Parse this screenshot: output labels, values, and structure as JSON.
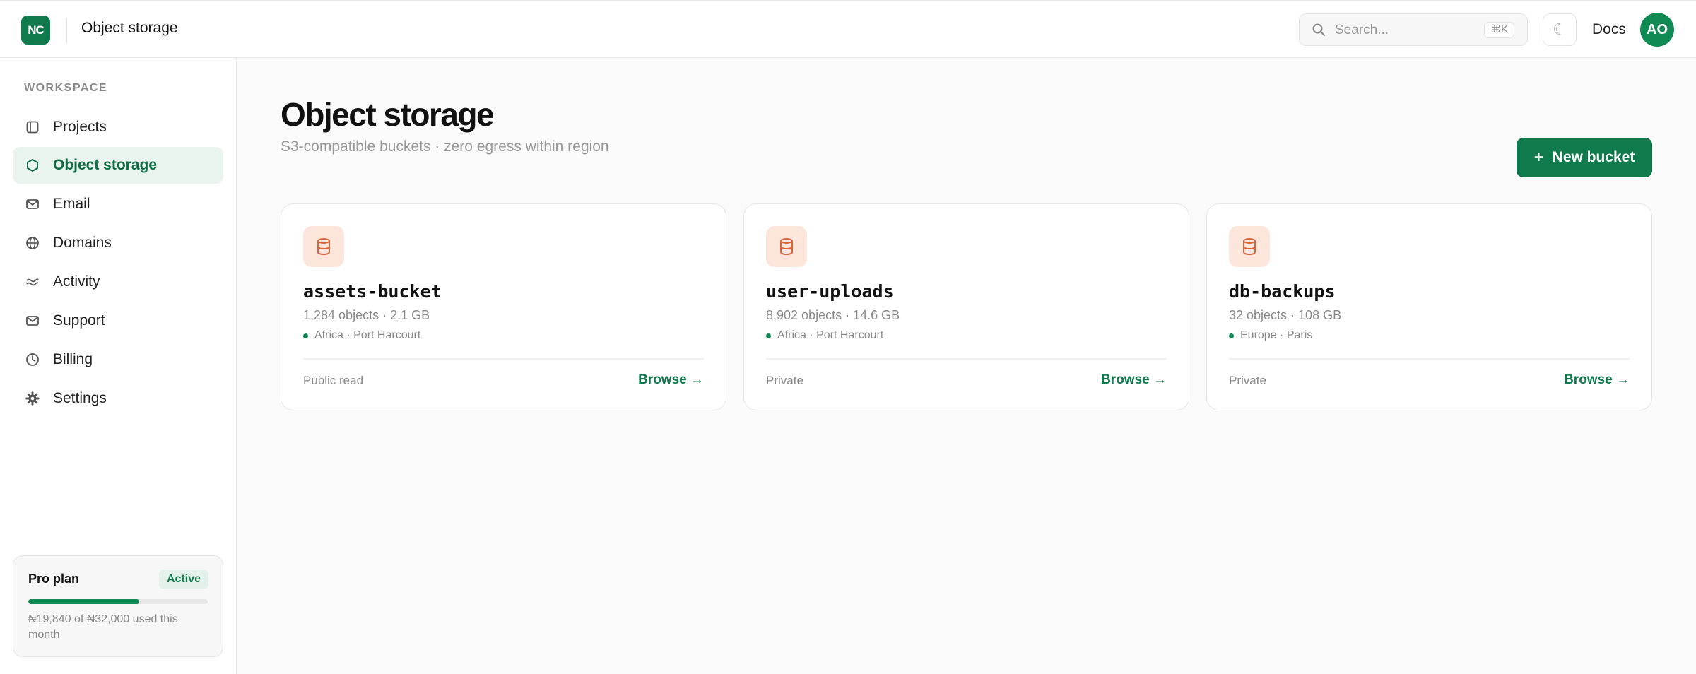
{
  "topbar": {
    "logo_text": "NC",
    "title": "Object storage",
    "search_placeholder": "Search...",
    "search_shortcut": "⌘K",
    "theme_icon": "moon-icon",
    "docs_label": "Docs",
    "avatar_initials": "AO"
  },
  "sidebar": {
    "section_label": "WORKSPACE",
    "items": [
      {
        "label": "Projects",
        "icon": "folder-icon",
        "active": false
      },
      {
        "label": "Object storage",
        "icon": "hexagon-icon",
        "active": true
      },
      {
        "label": "Email",
        "icon": "mail-icon",
        "active": false
      },
      {
        "label": "Domains",
        "icon": "globe-icon",
        "active": false
      },
      {
        "label": "Activity",
        "icon": "activity-icon",
        "active": false
      },
      {
        "label": "Support",
        "icon": "mail-icon",
        "active": false
      },
      {
        "label": "Billing",
        "icon": "clock-icon",
        "active": false
      },
      {
        "label": "Settings",
        "icon": "gear-icon",
        "active": false
      }
    ],
    "plan": {
      "title": "Pro plan",
      "badge": "Active",
      "usage_fraction": 0.62,
      "usage_text": "₦19,840 of ₦32,000 used this month"
    }
  },
  "main": {
    "title": "Object storage",
    "subtitle": "S3-compatible buckets · zero egress within region",
    "new_button": "New bucket",
    "buckets": [
      {
        "name": "assets-bucket",
        "stats": "1,284 objects · 2.1 GB",
        "region": "Africa · Port Harcourt",
        "access": "Public read",
        "browse": "Browse →"
      },
      {
        "name": "user-uploads",
        "stats": "8,902 objects · 14.6 GB",
        "region": "Africa · Port Harcourt",
        "access": "Private",
        "browse": "Browse →"
      },
      {
        "name": "db-backups",
        "stats": "32 objects · 108 GB",
        "region": "Europe · Paris",
        "access": "Private",
        "browse": "Browse →"
      }
    ]
  },
  "colors": {
    "brand": "#0f7a4c",
    "active_bg": "#e9f4ee",
    "bucket_icon_bg": "#fce6dc",
    "bucket_icon": "#d9653a"
  }
}
